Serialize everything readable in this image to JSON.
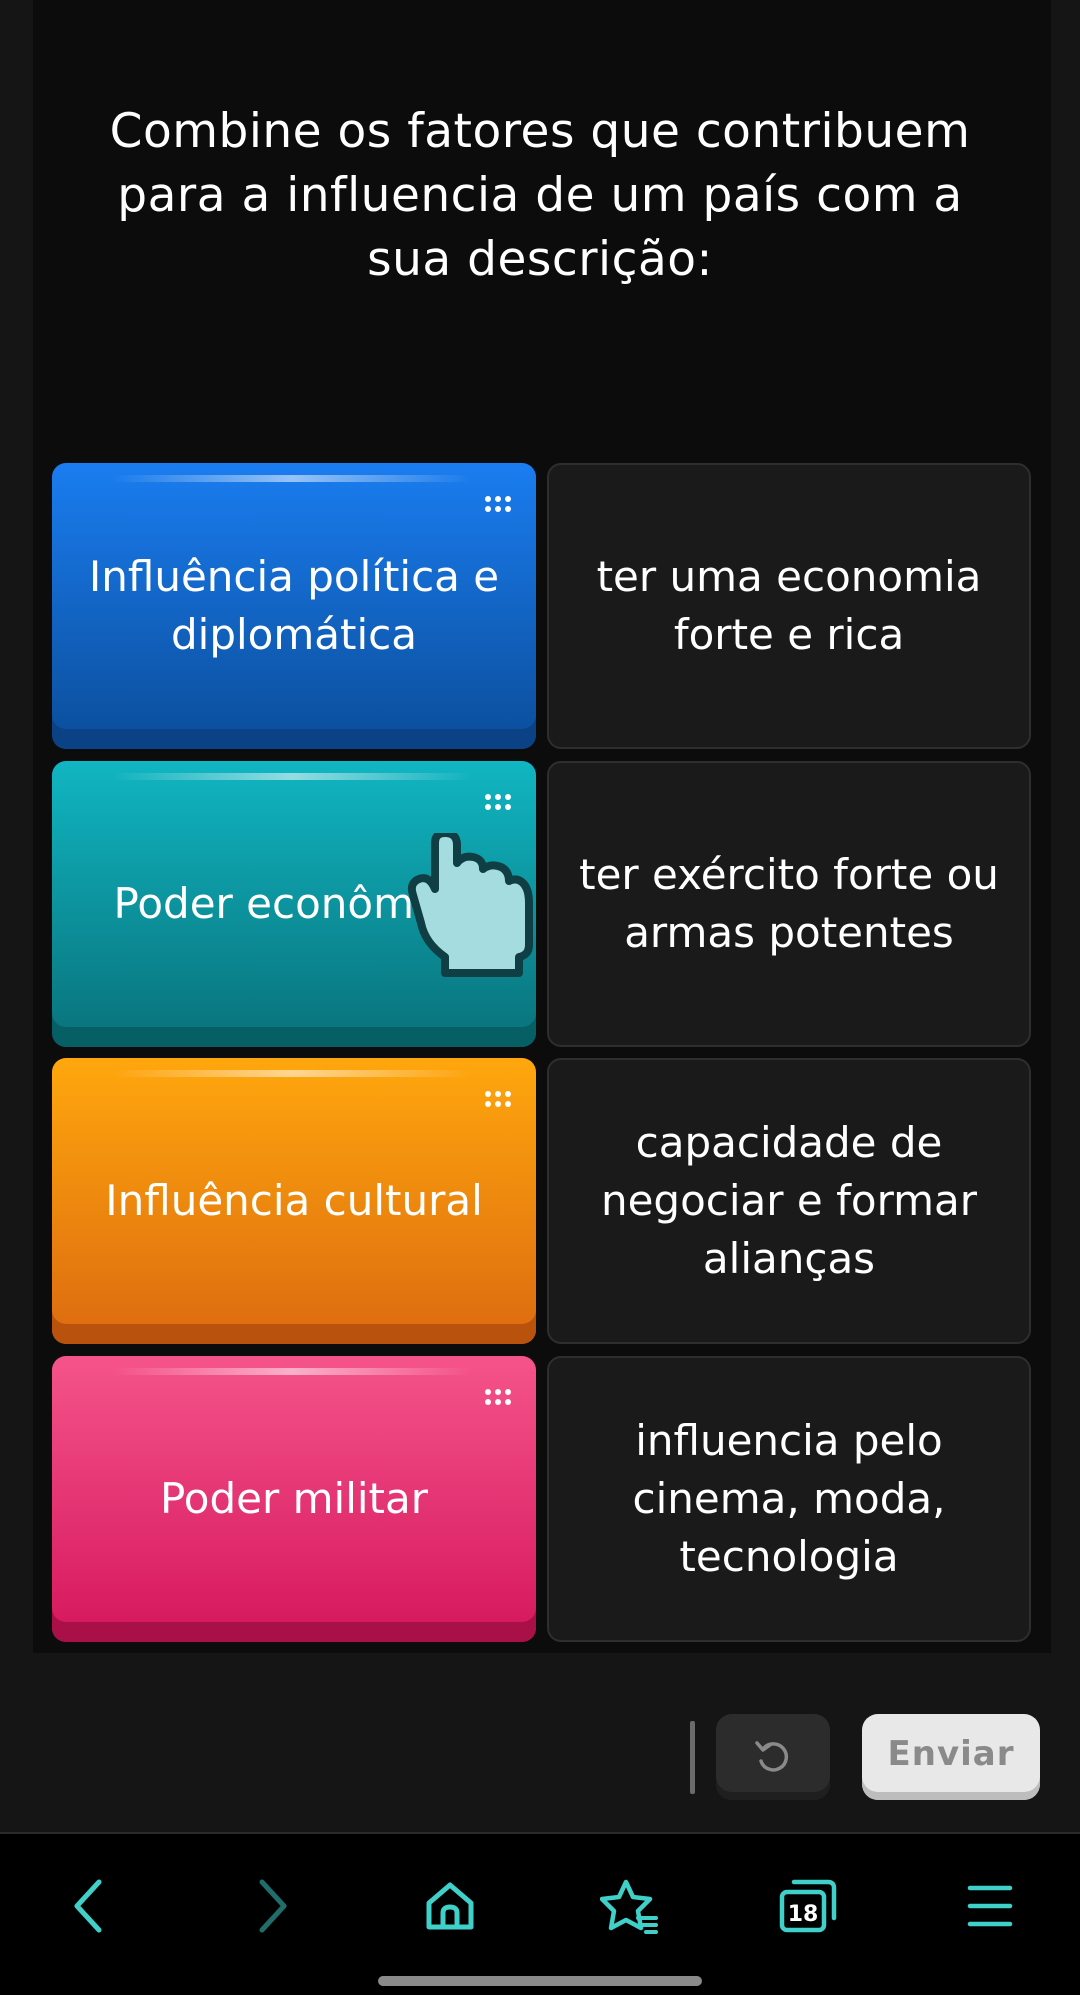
{
  "question": {
    "lines": [
      "Combine os fatores que contribuem",
      "para a influencia de um país com a",
      "sua descrição:"
    ]
  },
  "left_items": [
    {
      "lines": [
        "Influência política e",
        "diplomática"
      ],
      "color": "#1a7df0"
    },
    {
      "lines": [
        "Poder econômico"
      ],
      "color": "#10b6c2"
    },
    {
      "lines": [
        "Influência cultural"
      ],
      "color": "#ffa70d"
    },
    {
      "lines": [
        "Poder militar"
      ],
      "color": "#f5548a"
    }
  ],
  "right_items": [
    {
      "lines": [
        "ter uma economia",
        "forte e rica"
      ]
    },
    {
      "lines": [
        "ter exército forte ou",
        "armas potentes"
      ]
    },
    {
      "lines": [
        "capacidade de",
        "negociar e formar",
        "alianças"
      ]
    },
    {
      "lines": [
        "influencia pelo",
        "cinema, moda,",
        "tecnologia"
      ]
    }
  ],
  "actions": {
    "undo_icon": "undo-icon",
    "submit_label": "Enviar"
  },
  "nav": {
    "tabs_count": "18",
    "accent": "#3fd0c9"
  }
}
